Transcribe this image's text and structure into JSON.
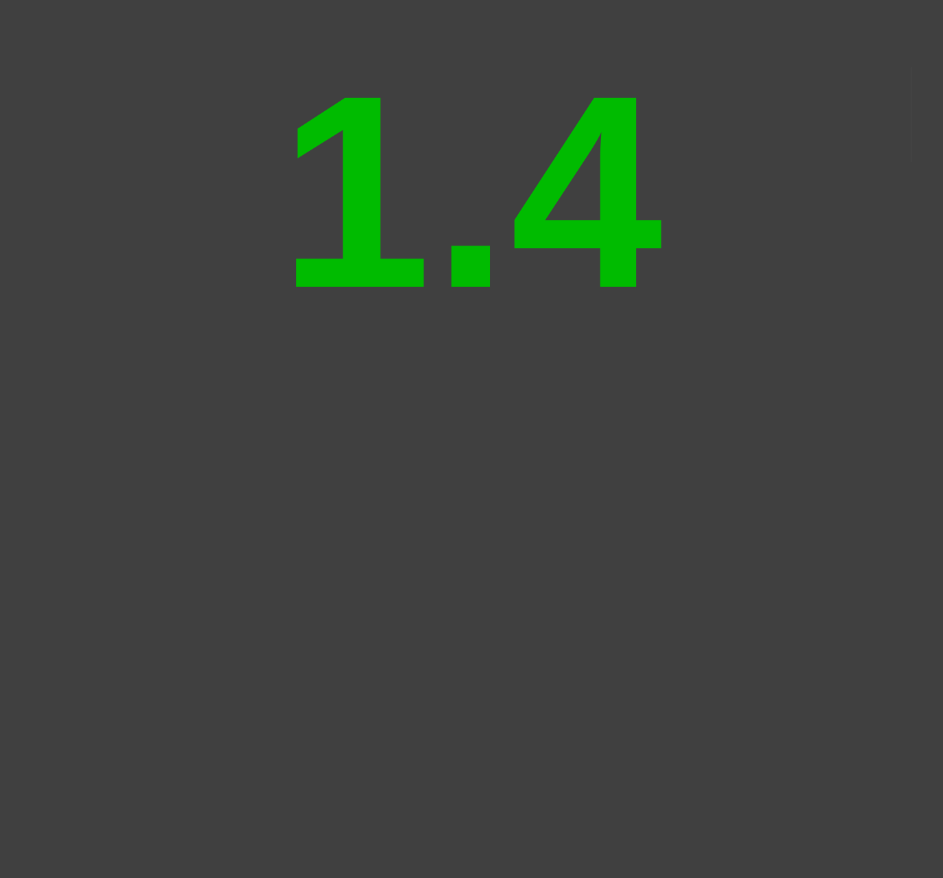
{
  "display": {
    "value": "1.4",
    "value_color": "#00bb00",
    "background_color": "#404040"
  }
}
